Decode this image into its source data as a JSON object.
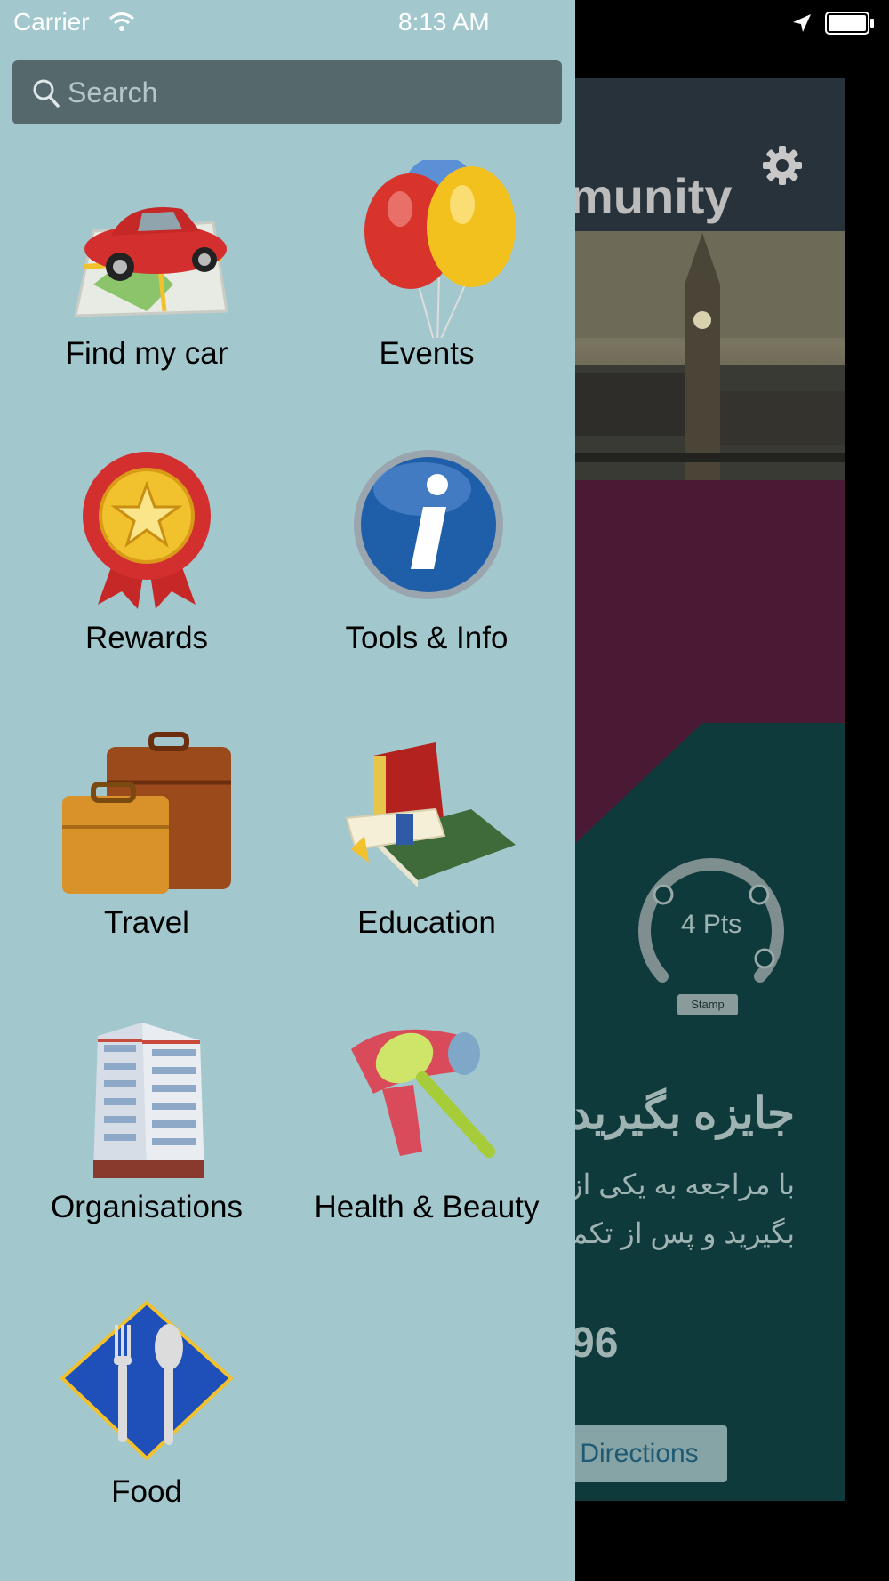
{
  "status_bar": {
    "carrier": "Carrier",
    "time": "8:13 AM"
  },
  "search": {
    "placeholder": "Search"
  },
  "menu": [
    {
      "label": "Find my car",
      "icon": "car-map-icon"
    },
    {
      "label": "Events",
      "icon": "balloons-icon"
    },
    {
      "label": "Rewards",
      "icon": "ribbon-medal-icon"
    },
    {
      "label": "Tools & Info",
      "icon": "info-icon"
    },
    {
      "label": "Travel",
      "icon": "suitcase-icon"
    },
    {
      "label": "Education",
      "icon": "books-diploma-icon"
    },
    {
      "label": "Organisations",
      "icon": "building-icon"
    },
    {
      "label": "Health & Beauty",
      "icon": "hairdryer-brush-icon"
    },
    {
      "label": "Food",
      "icon": "fork-spoon-icon"
    }
  ],
  "background_app": {
    "title": "munity",
    "points": "4 Pts",
    "stamp": "Stamp",
    "reward_heading": "جایزه بگیرید",
    "desc_line1": "با مراجعه به یکی از ف",
    "desc_line2": "بگیرید و پس از تکمیل",
    "number": "96",
    "directions_label": "Directions"
  },
  "colors": {
    "drawer_bg": "#a2c8ce",
    "search_bg": "#55696c",
    "magenta": "#4a1a34",
    "teal": "#0f3a3c"
  }
}
